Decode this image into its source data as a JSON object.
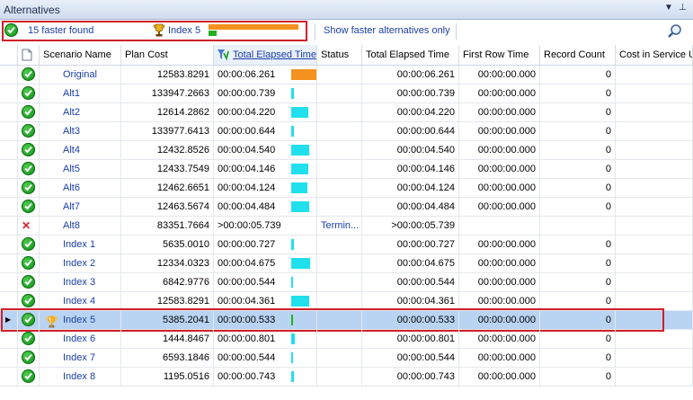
{
  "window": {
    "title": "Alternatives"
  },
  "toolbar": {
    "found_text": "15 faster found",
    "best_label": "Index 5",
    "best_ratio": 0.085,
    "faster_only_label": "Show faster alternatives only"
  },
  "columns": [
    "",
    "",
    "Scenario Name",
    "Plan Cost",
    "Total Elapsed Time",
    "Status",
    "Total Elapsed Time",
    "First Row Time",
    "Record Count",
    "Cost in Service U"
  ],
  "colors": {
    "orange": "#f5911e",
    "cyan": "#1fe0ec",
    "green": "#22b01f",
    "selected_row": "#b9d4f2",
    "highlight_border": "#d0202a"
  },
  "rows": [
    {
      "name": "Original",
      "cost": "12583.8291",
      "elapsed": "00:00:06.261",
      "status": "",
      "elapsed2": "00:00:06.261",
      "first": "00:00:00.000",
      "count": "0",
      "bar": 1.0,
      "bar_color": "orange",
      "icon": "ok",
      "selected": false
    },
    {
      "name": "Alt1",
      "cost": "133947.2663",
      "elapsed": "00:00:00.739",
      "status": "",
      "elapsed2": "00:00:00.739",
      "first": "00:00:00.000",
      "count": "0",
      "bar": 0.118,
      "bar_color": "cyan",
      "icon": "ok",
      "selected": false
    },
    {
      "name": "Alt2",
      "cost": "12614.2862",
      "elapsed": "00:00:04.220",
      "status": "",
      "elapsed2": "00:00:04.220",
      "first": "00:00:00.000",
      "count": "0",
      "bar": 0.674,
      "bar_color": "cyan",
      "icon": "ok",
      "selected": false
    },
    {
      "name": "Alt3",
      "cost": "133977.6413",
      "elapsed": "00:00:00.644",
      "status": "",
      "elapsed2": "00:00:00.644",
      "first": "00:00:00.000",
      "count": "0",
      "bar": 0.103,
      "bar_color": "cyan",
      "icon": "ok",
      "selected": false
    },
    {
      "name": "Alt4",
      "cost": "12432.8526",
      "elapsed": "00:00:04.540",
      "status": "",
      "elapsed2": "00:00:04.540",
      "first": "00:00:00.000",
      "count": "0",
      "bar": 0.725,
      "bar_color": "cyan",
      "icon": "ok",
      "selected": false
    },
    {
      "name": "Alt5",
      "cost": "12433.7549",
      "elapsed": "00:00:04.146",
      "status": "",
      "elapsed2": "00:00:04.146",
      "first": "00:00:00.000",
      "count": "0",
      "bar": 0.662,
      "bar_color": "cyan",
      "icon": "ok",
      "selected": false
    },
    {
      "name": "Alt6",
      "cost": "12462.6651",
      "elapsed": "00:00:04.124",
      "status": "",
      "elapsed2": "00:00:04.124",
      "first": "00:00:00.000",
      "count": "0",
      "bar": 0.659,
      "bar_color": "cyan",
      "icon": "ok",
      "selected": false
    },
    {
      "name": "Alt7",
      "cost": "12463.5674",
      "elapsed": "00:00:04.484",
      "status": "",
      "elapsed2": "00:00:04.484",
      "first": "00:00:00.000",
      "count": "0",
      "bar": 0.716,
      "bar_color": "cyan",
      "icon": "ok",
      "selected": false
    },
    {
      "name": "Alt8",
      "cost": "83351.7664",
      "elapsed": ">00:00:05.739",
      "status": "Termin...",
      "elapsed2": ">00:00:05.739",
      "first": "",
      "count": "",
      "bar": 0,
      "bar_color": "cyan",
      "icon": "terminated",
      "selected": false
    },
    {
      "name": "Index 1",
      "cost": "5635.0010",
      "elapsed": "00:00:00.727",
      "status": "",
      "elapsed2": "00:00:00.727",
      "first": "00:00:00.000",
      "count": "0",
      "bar": 0.116,
      "bar_color": "cyan",
      "icon": "ok",
      "selected": false
    },
    {
      "name": "Index 2",
      "cost": "12334.0323",
      "elapsed": "00:00:04.675",
      "status": "",
      "elapsed2": "00:00:04.675",
      "first": "00:00:00.000",
      "count": "0",
      "bar": 0.747,
      "bar_color": "cyan",
      "icon": "ok",
      "selected": false
    },
    {
      "name": "Index 3",
      "cost": "6842.9776",
      "elapsed": "00:00:00.544",
      "status": "",
      "elapsed2": "00:00:00.544",
      "first": "00:00:00.000",
      "count": "0",
      "bar": 0.087,
      "bar_color": "cyan",
      "icon": "ok",
      "selected": false
    },
    {
      "name": "Index 4",
      "cost": "12583.8291",
      "elapsed": "00:00:04.361",
      "status": "",
      "elapsed2": "00:00:04.361",
      "first": "00:00:00.000",
      "count": "0",
      "bar": 0.697,
      "bar_color": "cyan",
      "icon": "ok",
      "selected": false
    },
    {
      "name": "Index 5",
      "cost": "5385.2041",
      "elapsed": "00:00:00.533",
      "status": "",
      "elapsed2": "00:00:00.533",
      "first": "00:00:00.000",
      "count": "0",
      "bar": 0.085,
      "bar_color": "green",
      "icon": "ok",
      "selected": true
    },
    {
      "name": "Index 6",
      "cost": "1444.8467",
      "elapsed": "00:00:00.801",
      "status": "",
      "elapsed2": "00:00:00.801",
      "first": "00:00:00.000",
      "count": "0",
      "bar": 0.128,
      "bar_color": "cyan",
      "icon": "ok",
      "selected": false
    },
    {
      "name": "Index 7",
      "cost": "6593.1846",
      "elapsed": "00:00:00.544",
      "status": "",
      "elapsed2": "00:00:00.544",
      "first": "00:00:00.000",
      "count": "0",
      "bar": 0.087,
      "bar_color": "cyan",
      "icon": "ok",
      "selected": false
    },
    {
      "name": "Index 8",
      "cost": "1195.0516",
      "elapsed": "00:00:00.743",
      "status": "",
      "elapsed2": "00:00:00.743",
      "first": "00:00:00.000",
      "count": "0",
      "bar": 0.119,
      "bar_color": "cyan",
      "icon": "ok",
      "selected": false
    }
  ]
}
